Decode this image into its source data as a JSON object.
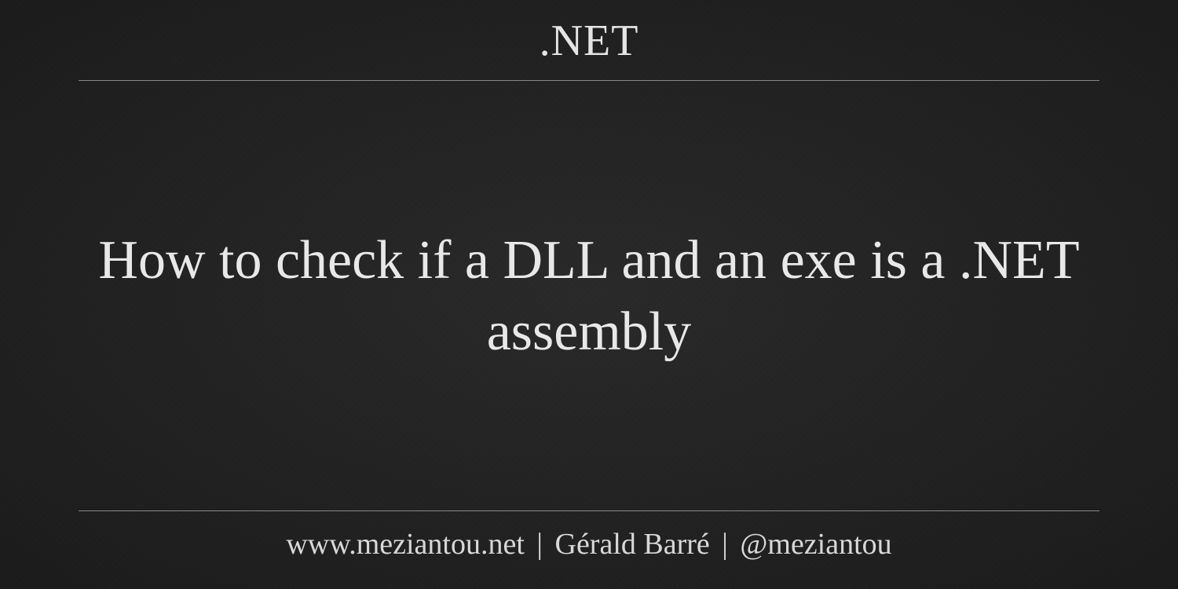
{
  "category": ".NET",
  "title": "How to check if a DLL and an exe is a .NET assembly",
  "footer": {
    "website": "www.meziantou.net",
    "author": "Gérald Barré",
    "handle": "@meziantou",
    "separator": "|"
  }
}
